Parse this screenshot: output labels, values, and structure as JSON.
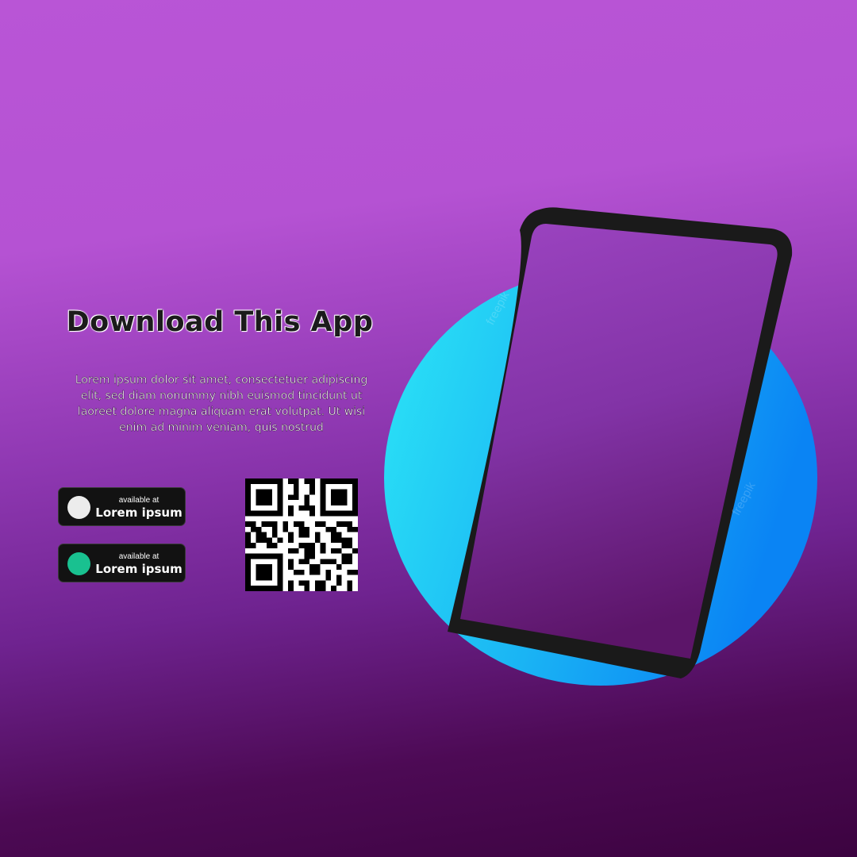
{
  "hero": {
    "title": "Download This App",
    "body_lines": [
      "Lorem ipsum dolor sit amet, consectetuer adipiscing",
      "elit, sed diam nonummy nibh euismod tincidunt ut",
      "laoreet dolore magna aliquam erat volutpat. Ut wisi",
      "enim ad minim veniam, quis nostrud"
    ]
  },
  "badges": [
    {
      "small_label": "available at",
      "label": "Lorem ipsum",
      "dot_color": "#ececec",
      "icon": "circle-icon"
    },
    {
      "small_label": "available at",
      "label": "Lorem ipsum",
      "dot_color": "#19c190",
      "icon": "circle-icon"
    }
  ],
  "qr": {
    "icon": "qr-code-icon"
  },
  "phone": {
    "icon": "smartphone-icon",
    "circle_color_start": "#2ce6f6",
    "circle_color_end": "#0a84f4",
    "frame_color": "#1a1a1a"
  },
  "colors": {
    "bg_top": "#b955d6",
    "bg_bottom": "#3c0340"
  }
}
